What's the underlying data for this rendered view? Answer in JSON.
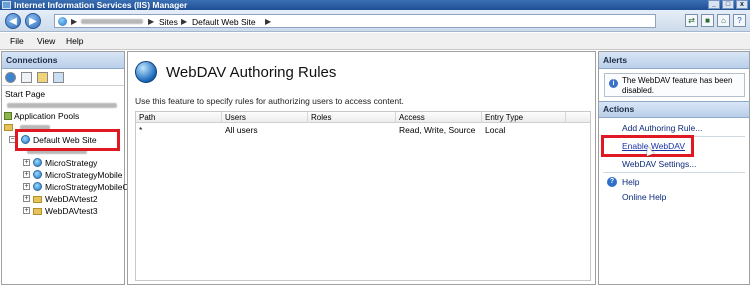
{
  "window": {
    "title": "Internet Information Services (IIS) Manager"
  },
  "address": {
    "crumbs": [
      "Sites",
      "Default Web Site"
    ],
    "separator": "▶"
  },
  "menu": [
    "File",
    "View",
    "Help"
  ],
  "connections": {
    "header": "Connections",
    "tree": {
      "start_page": "Start Page",
      "application_pools": "Application Pools",
      "default_site": "Default Web Site",
      "children": [
        "MicroStrategy",
        "MicroStrategyMobile",
        "MicroStrategyMobileO",
        "WebDAVtest2",
        "WebDAVtest3"
      ]
    }
  },
  "center": {
    "title": "WebDAV Authoring Rules",
    "description": "Use this feature to specify rules for authorizing users to access content.",
    "columns": [
      "Path",
      "Users",
      "Roles",
      "Access",
      "Entry Type"
    ],
    "rows": [
      {
        "path": "*",
        "users": "All users",
        "roles": "",
        "access": "Read, Write, Source",
        "entry_type": "Local"
      }
    ]
  },
  "alerts": {
    "header": "Alerts",
    "message": "The WebDAV feature has been disabled."
  },
  "actions": {
    "header": "Actions",
    "items": [
      "Add Authoring Rule...",
      "Enable WebDAV",
      "WebDAV Settings...",
      "Help",
      "Online Help"
    ]
  },
  "colors": {
    "highlight": "#e01824",
    "header": "#b9cfe9",
    "link": "#1a33a8"
  }
}
